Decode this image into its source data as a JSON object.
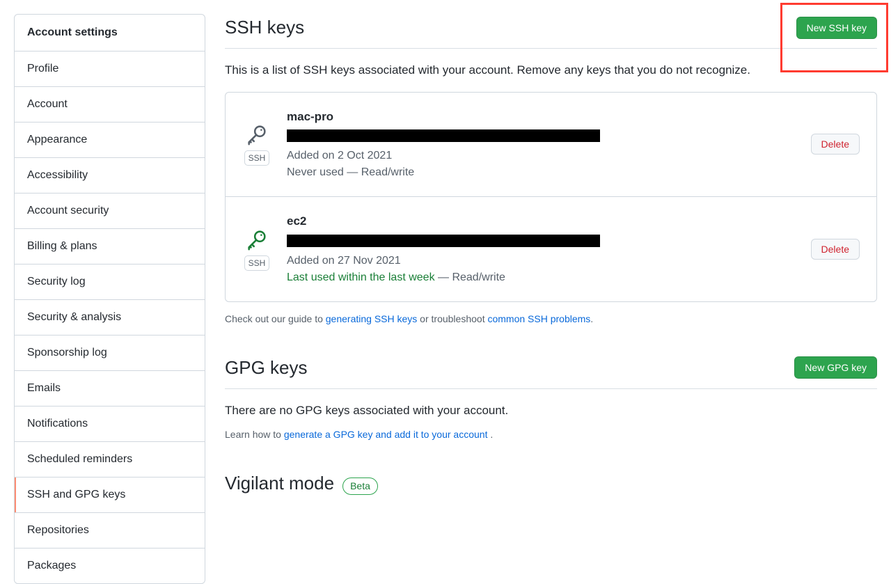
{
  "sidebar": {
    "header": "Account settings",
    "items": [
      "Profile",
      "Account",
      "Appearance",
      "Accessibility",
      "Account security",
      "Billing & plans",
      "Security log",
      "Security & analysis",
      "Sponsorship log",
      "Emails",
      "Notifications",
      "Scheduled reminders",
      "SSH and GPG keys",
      "Repositories",
      "Packages"
    ],
    "active_index": 12
  },
  "ssh": {
    "title": "SSH keys",
    "new_button": "New SSH key",
    "description": "This is a list of SSH keys associated with your account. Remove any keys that you do not recognize.",
    "delete_label": "Delete",
    "ssh_badge": "SSH",
    "keys": [
      {
        "name": "mac-pro",
        "added": "Added on 2 Oct 2021",
        "usage": "Never used — Read/write",
        "recent": false,
        "icon_color": "#57606a"
      },
      {
        "name": "ec2",
        "added": "Added on 27 Nov 2021",
        "usage": "Last used within the last week",
        "usage_suffix": " — Read/write",
        "recent": true,
        "icon_color": "#1a7f37"
      }
    ],
    "help_prefix": "Check out our guide to ",
    "help_link1": "generating SSH keys",
    "help_mid": " or troubleshoot ",
    "help_link2": "common SSH problems",
    "help_suffix": "."
  },
  "gpg": {
    "title": "GPG keys",
    "new_button": "New GPG key",
    "empty": "There are no GPG keys associated with your account.",
    "help_prefix": "Learn how to ",
    "help_link": "generate a GPG key and add it to your account ",
    "help_suffix": "."
  },
  "vigilant": {
    "title": "Vigilant mode",
    "badge": "Beta"
  }
}
